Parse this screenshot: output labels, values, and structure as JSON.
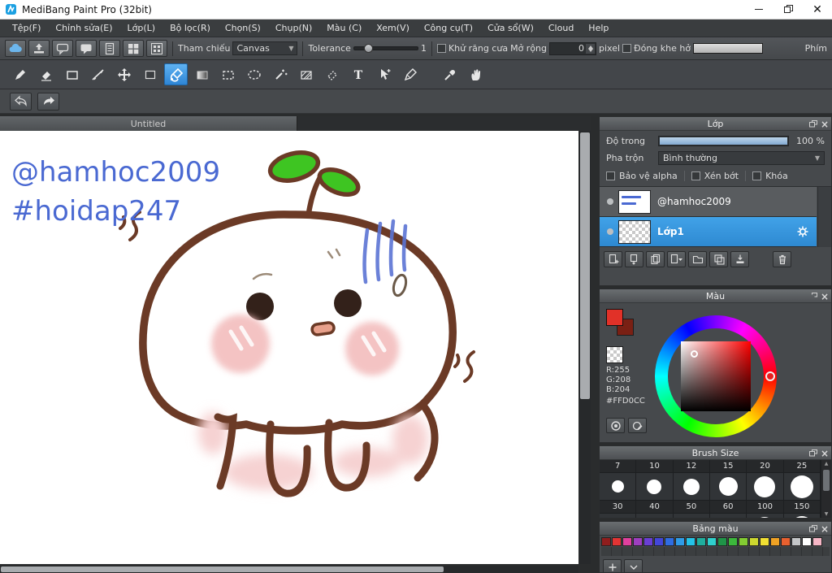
{
  "window": {
    "title": "MediBang Paint Pro (32bit)"
  },
  "menubar": {
    "items": [
      "Tệp(F)",
      "Chỉnh sửa(E)",
      "Lớp(L)",
      "Bộ lọc(R)",
      "Chọn(S)",
      "Chụp(N)",
      "Màu (C)",
      "Xem(V)",
      "Công cụ(T)",
      "Cửa sổ(W)",
      "Cloud",
      "Help"
    ]
  },
  "toolbar": {
    "reference_label": "Tham chiếu",
    "reference_value": "Canvas",
    "tolerance_label": "Tolerance",
    "tolerance_value": "1",
    "antialias_label": "Khử răng cưa",
    "expand_label": "Mở rộng",
    "expand_value": "0",
    "pixel_label": "pixel",
    "close_gap_label": "Đóng khe hở",
    "keys_label": "Phím"
  },
  "tools": [
    "Brush",
    "Eraser",
    "Rectangle",
    "Snap",
    "Move",
    "Fill Rectangle",
    "Bucket",
    "Gradient",
    "Select Rectangle",
    "Lasso",
    "Magic Wand",
    "Pattern Select",
    "Select Eraser",
    "Text",
    "Select Pen",
    "Pen",
    "Eyedropper",
    "Hand"
  ],
  "tabbar": {
    "active_tab": "Untitled"
  },
  "canvas": {
    "text_line1": "@hamhoc2009",
    "text_line2": "#hoidap247",
    "text_color": "#4a69d2"
  },
  "layer_panel": {
    "title": "Lớp",
    "opacity_label": "Độ trong",
    "opacity_value": "100 %",
    "blend_label": "Pha trộn",
    "blend_value": "Bình thường",
    "protect_alpha_label": "Bảo vệ alpha",
    "clipping_label": "Xén bớt",
    "lock_label": "Khóa",
    "layers": [
      {
        "name": "@hamhoc2009"
      },
      {
        "name": "Lớp1"
      }
    ]
  },
  "color_panel": {
    "title": "Màu",
    "r_label": "R:255",
    "g_label": "G:208",
    "b_label": "B:204",
    "hex_label": "#FFD0CC",
    "foreground_color": "#e13128",
    "background_color": "#7a2014"
  },
  "brush_panel": {
    "title": "Brush Size",
    "row1": [
      "7",
      "10",
      "12",
      "15",
      "20",
      "25"
    ],
    "row2": [
      "30",
      "40",
      "50",
      "60",
      "100",
      "150"
    ]
  },
  "palette_panel": {
    "title": "Bảng màu",
    "colors": [
      "#8f1d1d",
      "#e23434",
      "#e0409e",
      "#9e3fc0",
      "#6a3fd4",
      "#4346d8",
      "#2f6de2",
      "#2f9ce8",
      "#25c3e8",
      "#1fae9e",
      "#2fd0cd",
      "#1f9448",
      "#3cb83c",
      "#83cc32",
      "#cdd82f",
      "#f2e033",
      "#f0a224",
      "#e8602f",
      "#c4c6c8",
      "#ffffff",
      "#f6b6c6"
    ]
  }
}
